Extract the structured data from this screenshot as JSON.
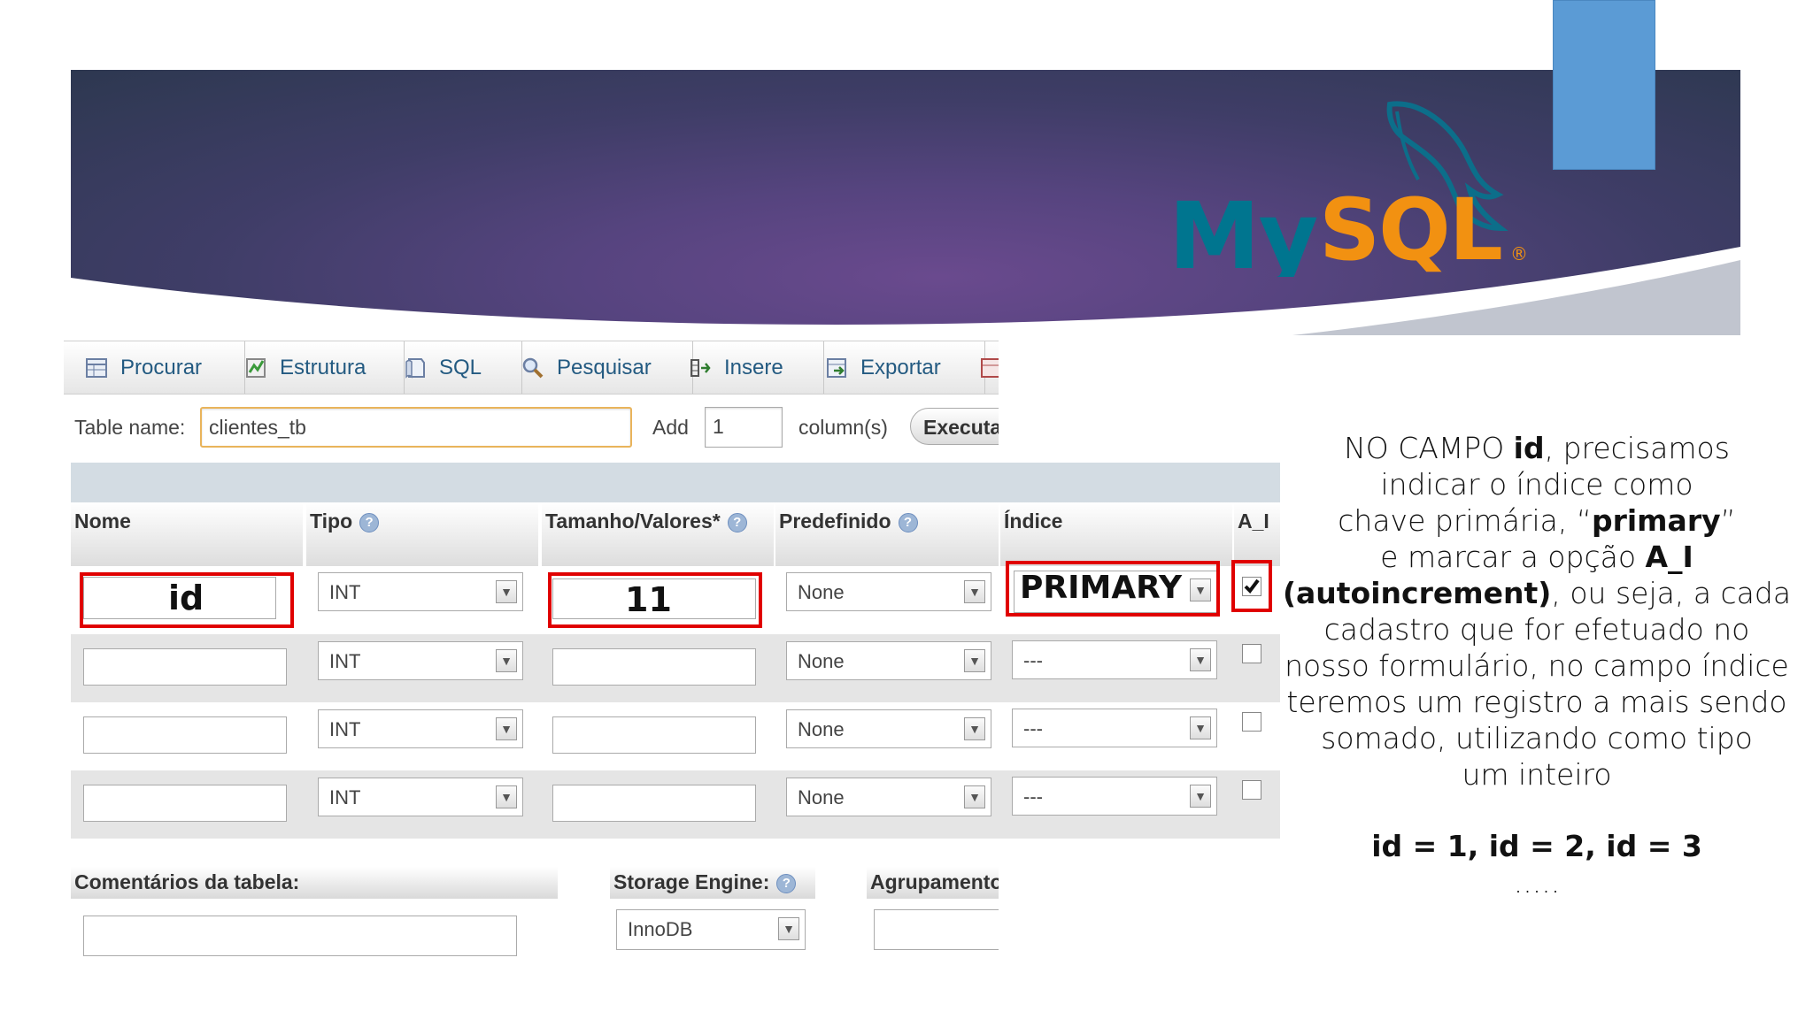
{
  "banner": {
    "logo_text": "MySQL"
  },
  "toolbar": {
    "tabs": [
      {
        "label": "Procurar",
        "icon": "browse-icon"
      },
      {
        "label": "Estrutura",
        "icon": "structure-icon"
      },
      {
        "label": "SQL",
        "icon": "sql-icon"
      },
      {
        "label": "Pesquisar",
        "icon": "search-icon"
      },
      {
        "label": "Insere",
        "icon": "insert-icon"
      },
      {
        "label": "Exportar",
        "icon": "export-icon"
      }
    ]
  },
  "table_name": {
    "label": "Table name:",
    "value": "clientes_tb"
  },
  "add_columns": {
    "label": "Add",
    "value": "1",
    "suffix": "column(s)",
    "button": "Executa"
  },
  "columns_header": {
    "nome": "Nome",
    "tipo": "Tipo",
    "tamanho": "Tamanho/Valores*",
    "predefinido": "Predefinido",
    "indice": "Índice",
    "ai": "A_I"
  },
  "rows": [
    {
      "nome": "id",
      "tipo": "INT",
      "tamanho": "11",
      "predefinido": "None",
      "indice": "PRIMARY",
      "ai": true
    },
    {
      "nome": "",
      "tipo": "INT",
      "tamanho": "",
      "predefinido": "None",
      "indice": "---",
      "ai": false
    },
    {
      "nome": "",
      "tipo": "INT",
      "tamanho": "",
      "predefinido": "None",
      "indice": "---",
      "ai": false
    },
    {
      "nome": "",
      "tipo": "INT",
      "tamanho": "",
      "predefinido": "None",
      "indice": "---",
      "ai": false
    }
  ],
  "bottom": {
    "comentarios_label": "Comentários da tabela:",
    "storage_label": "Storage Engine:",
    "storage_value": "InnoDB",
    "agrupamento_label": "Agrupamento"
  },
  "explanation": {
    "l1a": "NO CAMPO ",
    "l1b": "id",
    "l1c": ", precisamos",
    "l2": "indicar o índice como",
    "l3a": "chave primária, “",
    "l3b": "primary",
    "l3c": "”",
    "l4a": "e marcar a opção ",
    "l4b": "A_I",
    "l5a": "(autoincrement)",
    "l5b": ", ou seja, a cada",
    "l6": "cadastro que for efetuado no",
    "l7": "nosso formulário, no campo índice",
    "l8": "teremos um registro a mais sendo",
    "l9": "somado, utilizando como tipo",
    "l10": "um inteiro",
    "example": "id = 1, id = 2, id = 3",
    "dots": "....."
  },
  "colors": {
    "highlight": "#e00000",
    "link": "#235a81",
    "banner_accent": "#5b9bd5",
    "mysql_blue": "#00758f",
    "mysql_orange": "#f29111"
  }
}
